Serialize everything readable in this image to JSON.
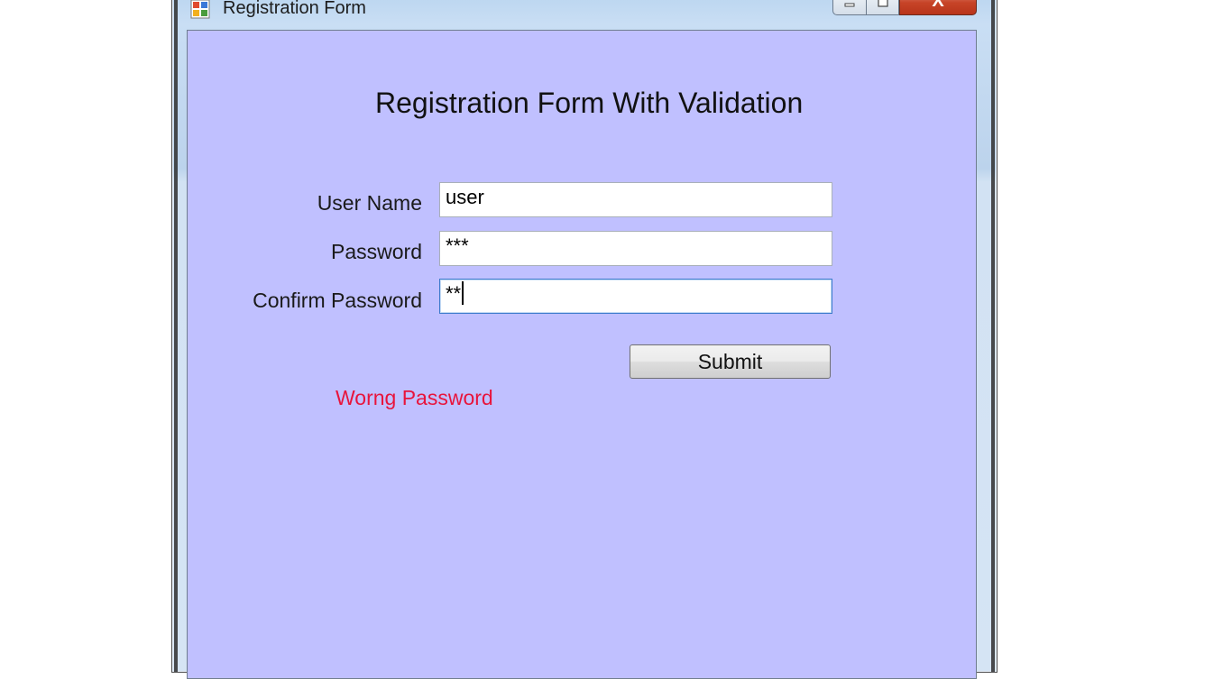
{
  "window": {
    "title": "Registration Form",
    "buttons": {
      "minimize": "minimize",
      "maximize": "maximize",
      "close": "X"
    }
  },
  "form": {
    "heading": "Registration Form With Validation",
    "fields": [
      {
        "label": "User Name",
        "value": "user"
      },
      {
        "label": "Password",
        "value": "***"
      },
      {
        "label": "Confirm Password",
        "value": "**"
      }
    ],
    "submit_label": "Submit",
    "error_message": "Worng Password"
  },
  "colors": {
    "client_background": "#c0c0ff",
    "error": "#e8143c",
    "close_button": "#c74428"
  },
  "icons": {
    "app": "form-app-icon",
    "minimize": "minimize-icon",
    "maximize": "maximize-icon",
    "close": "close-icon"
  }
}
